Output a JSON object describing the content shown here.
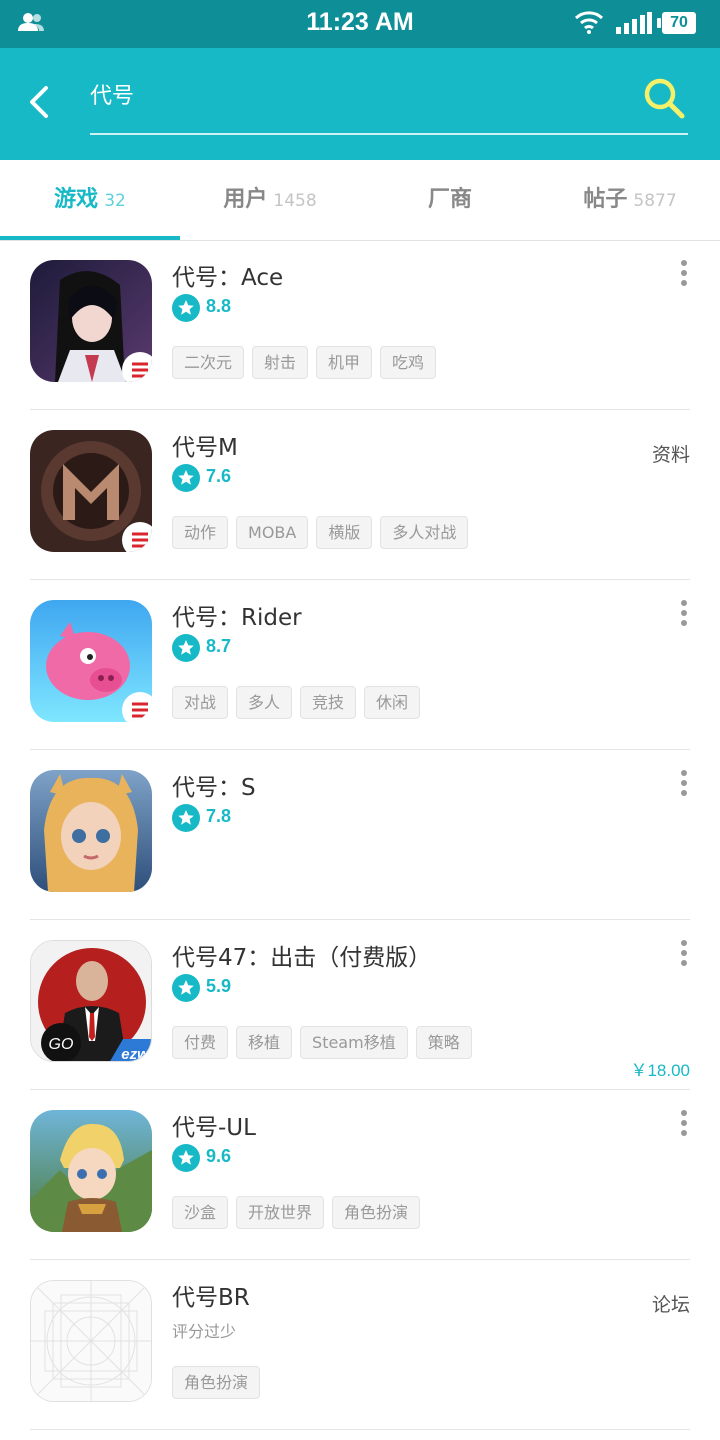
{
  "status_bar": {
    "time": "11:23 AM",
    "battery": "70"
  },
  "search": {
    "value": "代号"
  },
  "tabs": [
    {
      "label": "游戏",
      "count": "32"
    },
    {
      "label": "用户",
      "count": "1458"
    },
    {
      "label": "厂商",
      "count": ""
    },
    {
      "label": "帖子",
      "count": "5877"
    }
  ],
  "games": [
    {
      "title": "代号：Ace",
      "rating": "8.8",
      "tags": [
        "二次元",
        "射击",
        "机甲",
        "吃鸡"
      ],
      "action": "more"
    },
    {
      "title": "代号M",
      "rating": "7.6",
      "tags": [
        "动作",
        "MOBA",
        "横版",
        "多人对战"
      ],
      "side_link": "资料"
    },
    {
      "title": "代号：Rider",
      "rating": "8.7",
      "tags": [
        "对战",
        "多人",
        "竞技",
        "休闲"
      ],
      "action": "more"
    },
    {
      "title": "代号：S",
      "rating": "7.8",
      "tags": [],
      "action": "more"
    },
    {
      "title": "代号47：出击（付费版）",
      "rating": "5.9",
      "tags": [
        "付费",
        "移植",
        "Steam移植",
        "策略"
      ],
      "action": "more",
      "price": "￥18.00",
      "icon_badge": "GO",
      "icon_brand": "ezw"
    },
    {
      "title": "代号-UL",
      "rating": "9.6",
      "tags": [
        "沙盒",
        "开放世界",
        "角色扮演"
      ],
      "action": "more"
    },
    {
      "title": "代号BR",
      "rating_text": "评分过少",
      "tags": [
        "角色扮演"
      ],
      "side_link": "论坛"
    }
  ],
  "colors": {
    "accent": "#17b9c7",
    "status_bar": "#0e8f98",
    "search_icon": "#f5f06a"
  }
}
